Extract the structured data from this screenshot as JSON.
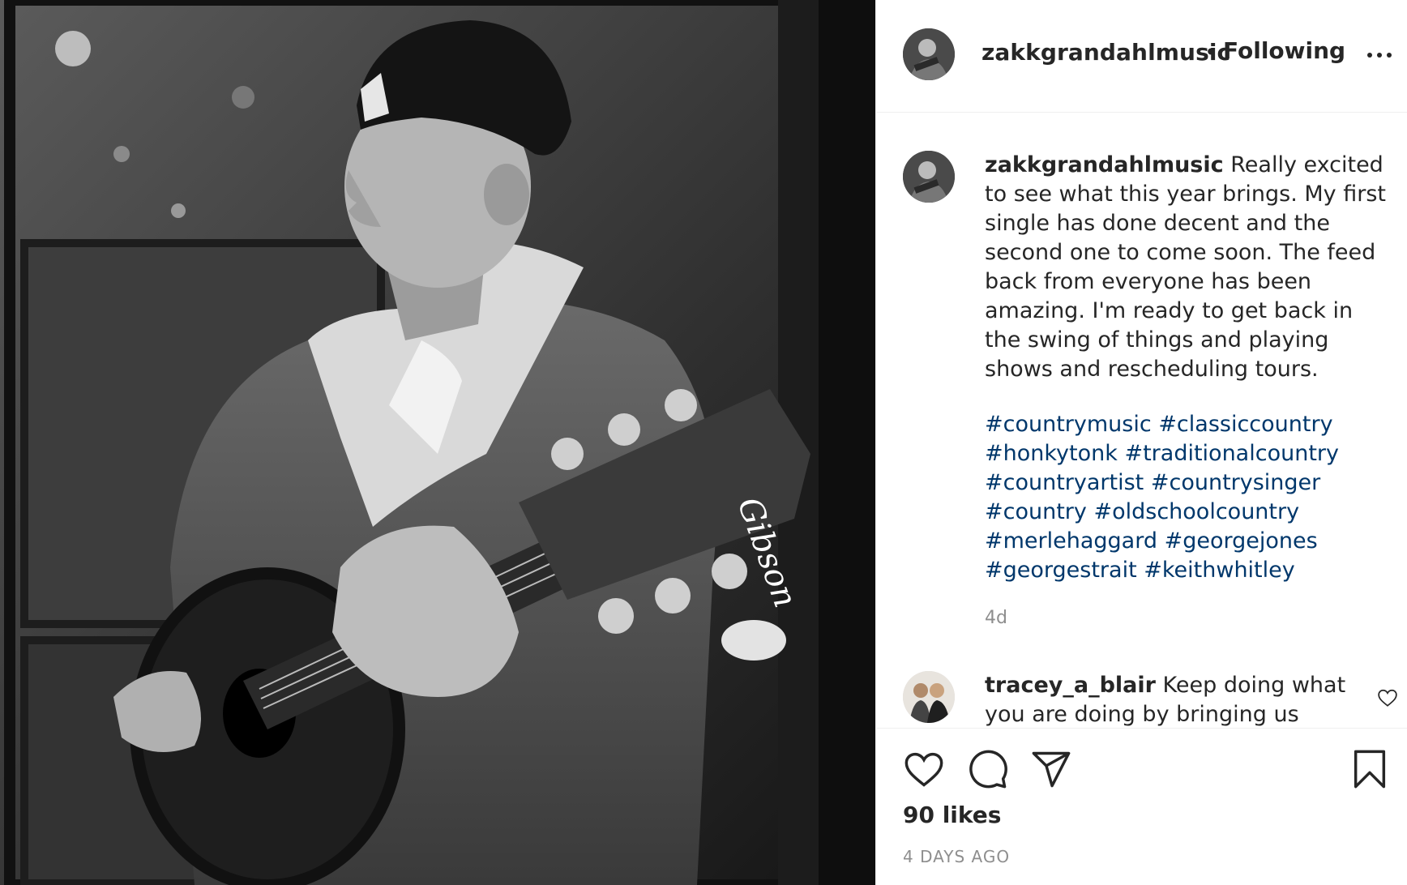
{
  "post": {
    "username": "zakkgrandahlmusic",
    "separator": "•",
    "follow_status": "Following",
    "more_icon": "more-horizontal-icon",
    "photo_headstock_text": "Gibson"
  },
  "caption": {
    "username": "zakkgrandahlmusic",
    "text": "Really excited to see what this year brings. My first single has done decent and the second one to come soon. The feed back from everyone has been amazing. I'm ready to get back in the swing of things and playing shows and rescheduling tours.",
    "hashtags": [
      "#countrymusic",
      "#classiccountry",
      "#honkytonk",
      "#traditionalcountry",
      "#countryartist",
      "#countrysinger",
      "#country",
      "#oldschoolcountry",
      "#merlehaggard",
      "#georgejones",
      "#georgestrait",
      "#keithwhitley"
    ],
    "time": "4d"
  },
  "comments": [
    {
      "username": "tracey_a_blair",
      "text": "Keep doing what you are doing by bringing us"
    }
  ],
  "actions": {
    "like_icon": "heart-icon",
    "comment_icon": "comment-bubble-icon",
    "share_icon": "paper-plane-icon",
    "save_icon": "bookmark-icon"
  },
  "likes_text": "90 likes",
  "posted_ago": "4 DAYS AGO",
  "colors": {
    "hashtag": "#00376b",
    "muted": "#8e8e8e",
    "text": "#262626",
    "border": "#efefef"
  }
}
